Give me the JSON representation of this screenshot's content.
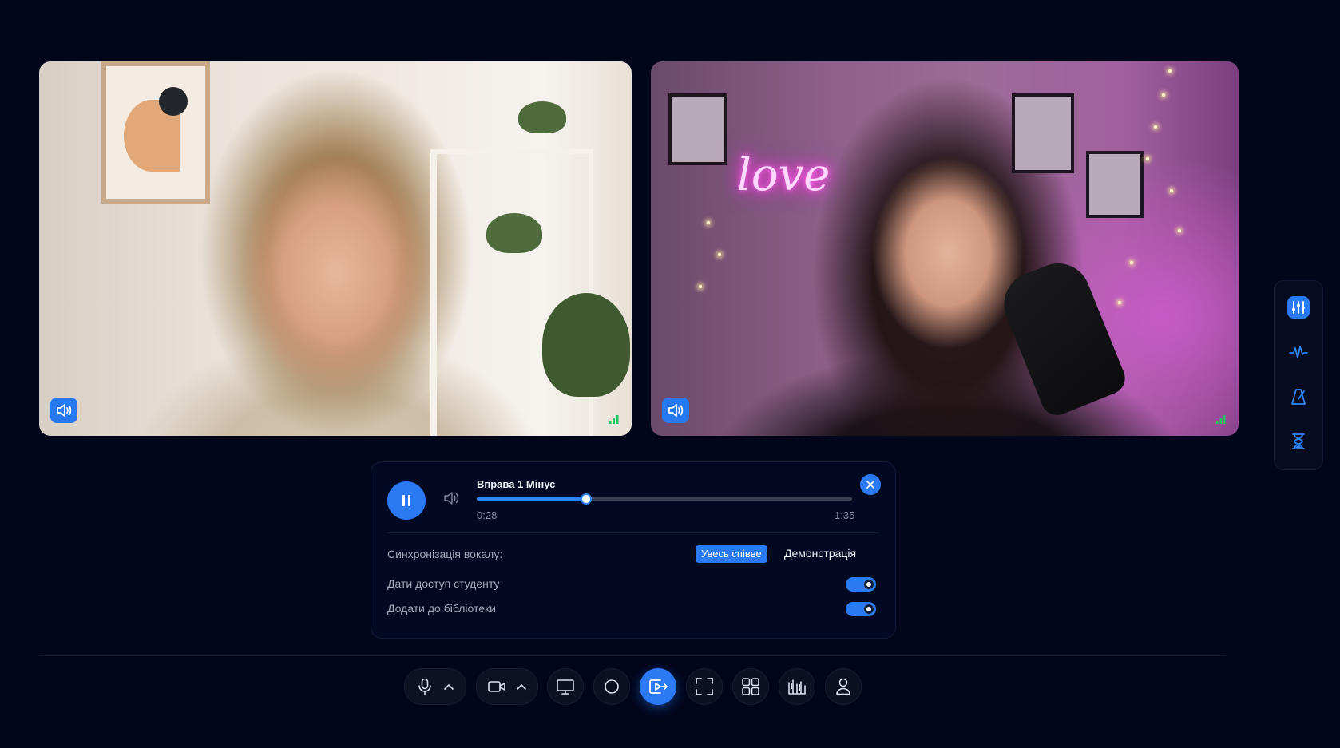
{
  "participants": [
    {
      "audio_icon": "speaker-icon",
      "signal_icon": "signal-bars-icon"
    },
    {
      "audio_icon": "speaker-icon",
      "signal_icon": "signal-bars-icon"
    }
  ],
  "player": {
    "title": "Вправа 1 Мінус",
    "current_time": "0:28",
    "total_time": "1:35",
    "progress": 0.29,
    "state": "playing",
    "sync_label": "Синхронізація вокалу:",
    "sync_options": [
      "Увесь співве",
      "Демонстрація"
    ],
    "sync_selected": "Увесь співве",
    "student_access_label": "Дати доступ студенту",
    "student_access": true,
    "library_label": "Додати до бібліотеки",
    "library": true
  },
  "side_tools": [
    "mixer-icon",
    "waveform-icon",
    "metronome-icon",
    "hourglass-icon"
  ],
  "toolbar": [
    "microphone-icon",
    "camera-icon",
    "screen-share-icon",
    "record-icon",
    "media-player-icon",
    "fullscreen-icon",
    "grid-layout-icon",
    "piano-icon",
    "profile-icon"
  ],
  "colors": {
    "accent": "#2a7bf3",
    "background": "#02061a",
    "panel": "#040923",
    "signal": "#22c55e"
  }
}
